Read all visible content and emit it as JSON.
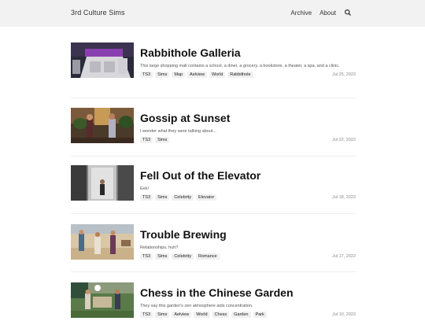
{
  "header": {
    "brand": "3rd Culture Sims",
    "nav": {
      "archive": "Archive",
      "about": "About"
    }
  },
  "posts": [
    {
      "title": "Rabbithole Galleria",
      "description": "This large shopping mall contains a school, a diner, a grocery, a bookstore, a theater, a spa, and a clinic.",
      "tags": [
        "TS3",
        "Sims",
        "Map",
        "Aelview",
        "World",
        "Rabbithole"
      ],
      "date": "Jul 25, 2022"
    },
    {
      "title": "Gossip at Sunset",
      "description": "I wonder what they were talking about...",
      "tags": [
        "TS3",
        "Sims"
      ],
      "date": "Jul 22, 2022"
    },
    {
      "title": "Fell Out of the Elevator",
      "description": "Eek!",
      "tags": [
        "TS3",
        "Sims",
        "Celebrity",
        "Elevator"
      ],
      "date": "Jul 18, 2022"
    },
    {
      "title": "Trouble Brewing",
      "description": "Relationships, huh?",
      "tags": [
        "TS3",
        "Sims",
        "Celebrity",
        "Romance"
      ],
      "date": "Jul 17, 2022"
    },
    {
      "title": "Chess in the Chinese Garden",
      "description": "They say this garden's zen atmosphere aids concentration.",
      "tags": [
        "TS3",
        "Sims",
        "Aelview",
        "World",
        "Chess",
        "Garden",
        "Park"
      ],
      "date": "Jul 10, 2022"
    }
  ]
}
